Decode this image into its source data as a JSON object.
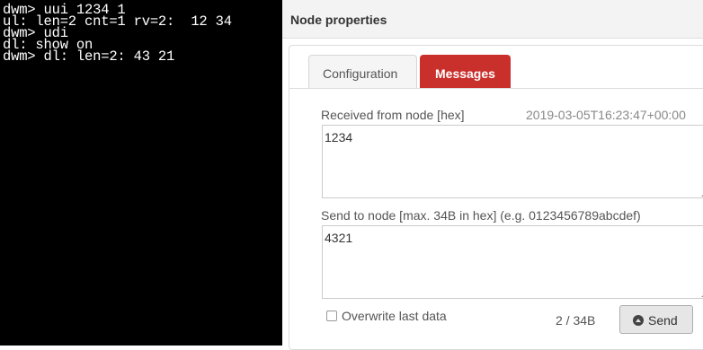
{
  "terminal": {
    "lines": [
      "dwm> uui 1234 1",
      "ul: len=2 cnt=1 rv=2:  12 34",
      "dwm> udi",
      "dl: show on",
      "dwm> dl: len=2: 43 21"
    ]
  },
  "panel": {
    "title": "Node properties",
    "tabs": [
      {
        "label": "Configuration",
        "active": false
      },
      {
        "label": "Messages",
        "active": true
      }
    ],
    "received": {
      "label": "Received from node [hex]",
      "timestamp": "2019-03-05T16:23:47+00:00",
      "value": "1234"
    },
    "send": {
      "label": "Send to node [max. 34B in hex] (e.g. 0123456789abcdef)",
      "value": "4321"
    },
    "overwrite_label": "Overwrite last data",
    "overwrite_checked": false,
    "counter": "2 / 34B",
    "send_button": "Send",
    "send_icon": "upload-circle-icon"
  },
  "colors": {
    "active_tab": "#c9302c",
    "terminal_bg": "#000000"
  }
}
